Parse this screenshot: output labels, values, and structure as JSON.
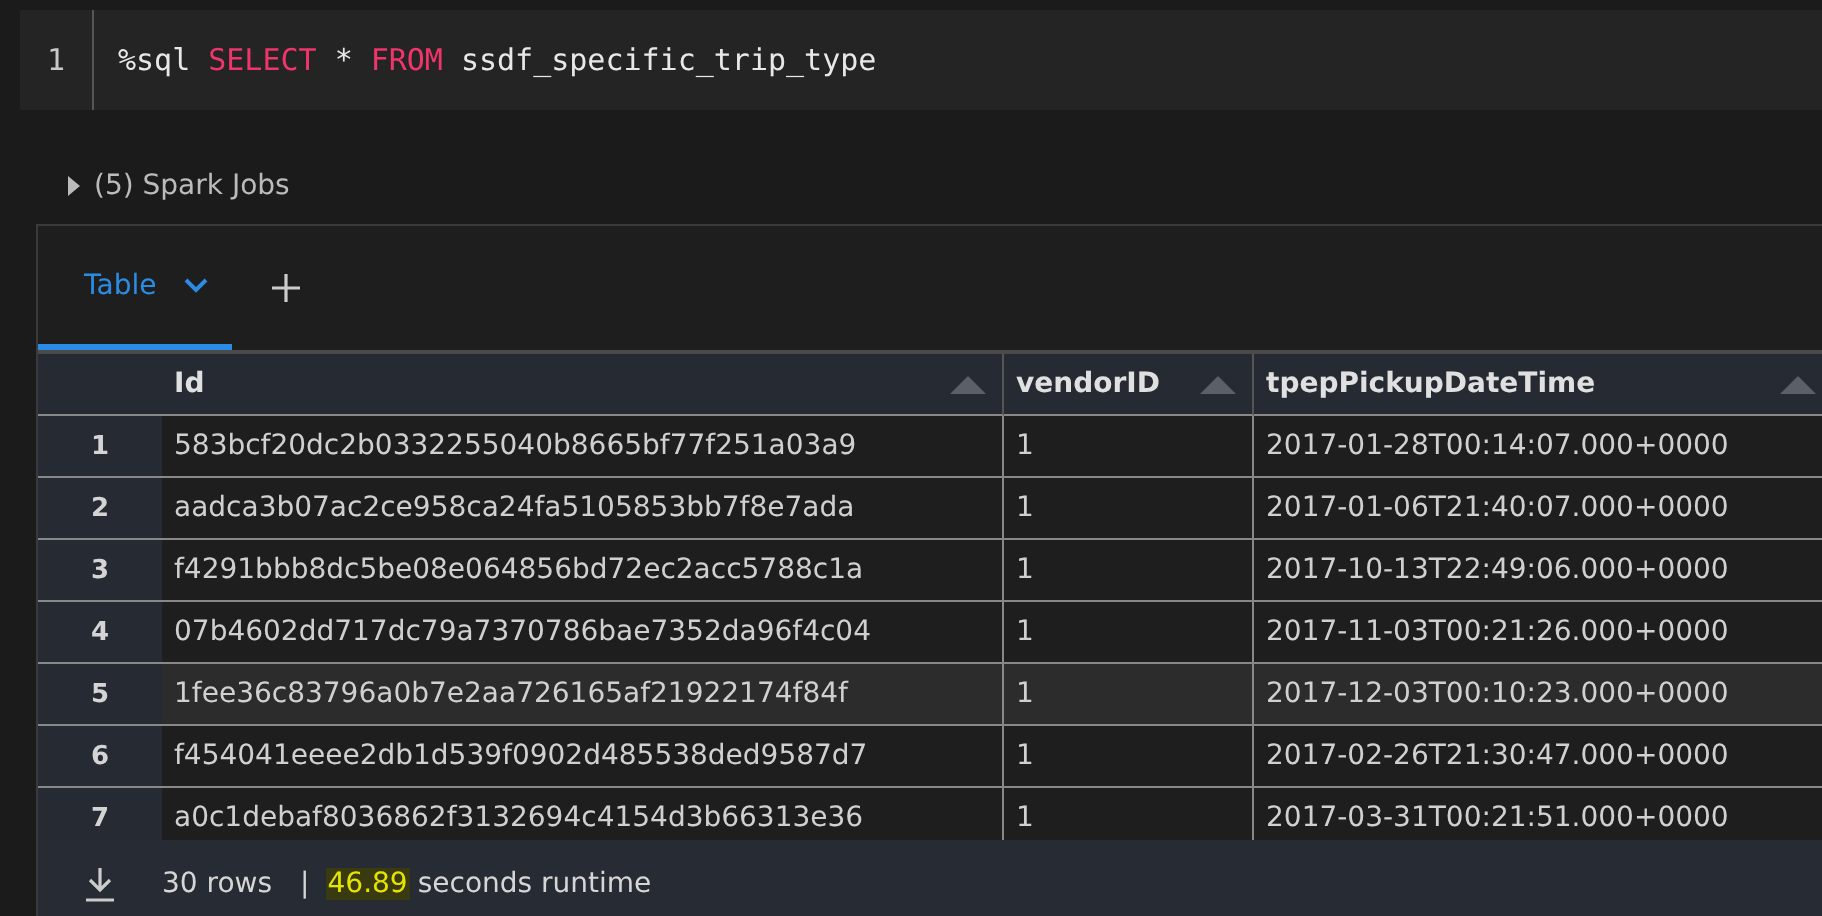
{
  "code_cell": {
    "line_number": "1",
    "tokens": [
      {
        "text": "%sql",
        "kind": "plain"
      },
      {
        "text": "SELECT",
        "kind": "keyword"
      },
      {
        "text": "*",
        "kind": "plain"
      },
      {
        "text": "FROM",
        "kind": "keyword"
      },
      {
        "text": "ssdf_specific_trip_type",
        "kind": "plain"
      }
    ]
  },
  "spark_jobs": {
    "label": "(5) Spark Jobs",
    "expanded": false
  },
  "tabs": [
    {
      "label": "Table",
      "selected": true
    }
  ],
  "table": {
    "columns": [
      "Id",
      "vendorID",
      "tpepPickupDateTime"
    ],
    "rows": [
      {
        "index": "1",
        "cells": [
          "583bcf20dc2b0332255040b8665bf77f251a03a9",
          "1",
          "2017-01-28T00:14:07.000+0000"
        ],
        "highlighted": false
      },
      {
        "index": "2",
        "cells": [
          "aadca3b07ac2ce958ca24fa5105853bb7f8e7ada",
          "1",
          "2017-01-06T21:40:07.000+0000"
        ],
        "highlighted": false
      },
      {
        "index": "3",
        "cells": [
          "f4291bbb8dc5be08e064856bd72ec2acc5788c1a",
          "1",
          "2017-10-13T22:49:06.000+0000"
        ],
        "highlighted": false
      },
      {
        "index": "4",
        "cells": [
          "07b4602dd717dc79a7370786bae7352da96f4c04",
          "1",
          "2017-11-03T00:21:26.000+0000"
        ],
        "highlighted": false
      },
      {
        "index": "5",
        "cells": [
          "1fee36c83796a0b7e2aa726165af21922174f84f",
          "1",
          "2017-12-03T00:10:23.000+0000"
        ],
        "highlighted": true
      },
      {
        "index": "6",
        "cells": [
          "f454041eeee2db1d539f0902d485538ded9587d7",
          "1",
          "2017-02-26T21:30:47.000+0000"
        ],
        "highlighted": false
      },
      {
        "index": "7",
        "cells": [
          "a0c1debaf8036862f3132694c4154d3b66313e36",
          "1",
          "2017-03-31T00:21:51.000+0000"
        ],
        "highlighted": false
      }
    ]
  },
  "footer": {
    "rows": "30 rows",
    "separator": "|",
    "runtime_value": "46.89",
    "runtime_label": "seconds runtime"
  }
}
